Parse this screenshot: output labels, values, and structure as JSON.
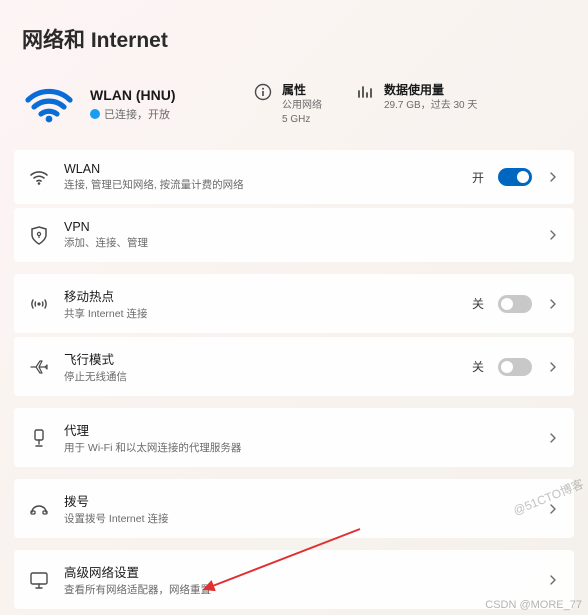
{
  "page": {
    "title": "网络和 Internet"
  },
  "connection": {
    "name": "WLAN (HNU)",
    "status": "已连接，开放"
  },
  "properties": {
    "label": "属性",
    "line1": "公用网络",
    "line2": "5 GHz"
  },
  "usage": {
    "label": "数据使用量",
    "value": "29.7 GB，过去 30 天"
  },
  "rows": {
    "wlan": {
      "title": "WLAN",
      "desc": "连接, 管理已知网络, 按流量计费的网络",
      "state": "开"
    },
    "vpn": {
      "title": "VPN",
      "desc": "添加、连接、管理"
    },
    "hotspot": {
      "title": "移动热点",
      "desc": "共享 Internet 连接",
      "state": "关"
    },
    "airplane": {
      "title": "飞行模式",
      "desc": "停止无线通信",
      "state": "关"
    },
    "proxy": {
      "title": "代理",
      "desc": "用于 Wi-Fi 和以太网连接的代理服务器"
    },
    "dialup": {
      "title": "拨号",
      "desc": "设置拨号 Internet 连接"
    },
    "advanced": {
      "title": "高级网络设置",
      "desc": "查看所有网络适配器，网络重置"
    }
  },
  "watermarks": {
    "diag": "@51CTO博客",
    "bottom": "CSDN @MORE_77"
  }
}
